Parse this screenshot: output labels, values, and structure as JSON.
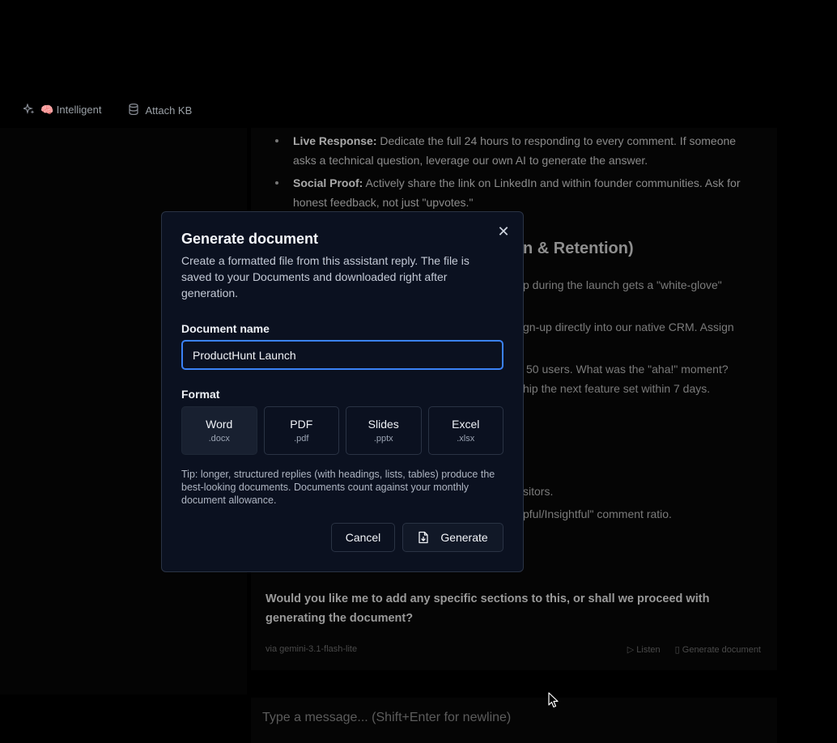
{
  "toolbar": {
    "mode_label": "🧠 Intelligent",
    "attach_label": "Attach KB"
  },
  "chat": {
    "bullets": [
      {
        "bold": "Live Response:",
        "text": " Dedicate the full 24 hours to responding to every comment. If someone asks a technical question, leverage our own AI to generate the answer."
      },
      {
        "bold": "Social Proof:",
        "text": " Actively share the link on LinkedIn and within founder communities. Ask for honest feedback, not just \"upvotes.\""
      }
    ],
    "heading_fragment": "n & Retention)",
    "line_fragments": [
      "p during the launch gets a \"white-glove\"",
      "gn-up directly into our native CRM. Assign",
      "50 users. What was the \"aha!\" moment?",
      "hip the next feature set within 7 days.",
      "sitors.",
      "pful/Insightful\" comment ratio."
    ],
    "question": "Would you like me to add any specific sections to this, or shall we proceed with generating the document?",
    "via": "via gemini-3.1-flash-lite",
    "listen_label": "Listen",
    "generate_doc_label": "Generate document"
  },
  "composer": {
    "placeholder": "Type a message... (Shift+Enter for newline)"
  },
  "modal": {
    "title": "Generate document",
    "description": "Create a formatted file from this assistant reply. The file is saved to your Documents and downloaded right after generation.",
    "name_label": "Document name",
    "name_value": "ProductHunt Launch",
    "format_label": "Format",
    "formats": [
      {
        "name": "Word",
        "ext": ".docx",
        "selected": true
      },
      {
        "name": "PDF",
        "ext": ".pdf",
        "selected": false
      },
      {
        "name": "Slides",
        "ext": ".pptx",
        "selected": false
      },
      {
        "name": "Excel",
        "ext": ".xlsx",
        "selected": false
      }
    ],
    "tip": "Tip: longer, structured replies (with headings, lists, tables) produce the best-looking documents. Documents count against your monthly document allowance.",
    "cancel_label": "Cancel",
    "generate_label": "Generate",
    "close_symbol": "✕"
  },
  "colors": {
    "modal_bg": "#0b1120",
    "focus_ring": "#3b82f6",
    "selected_format_bg": "#182030"
  }
}
